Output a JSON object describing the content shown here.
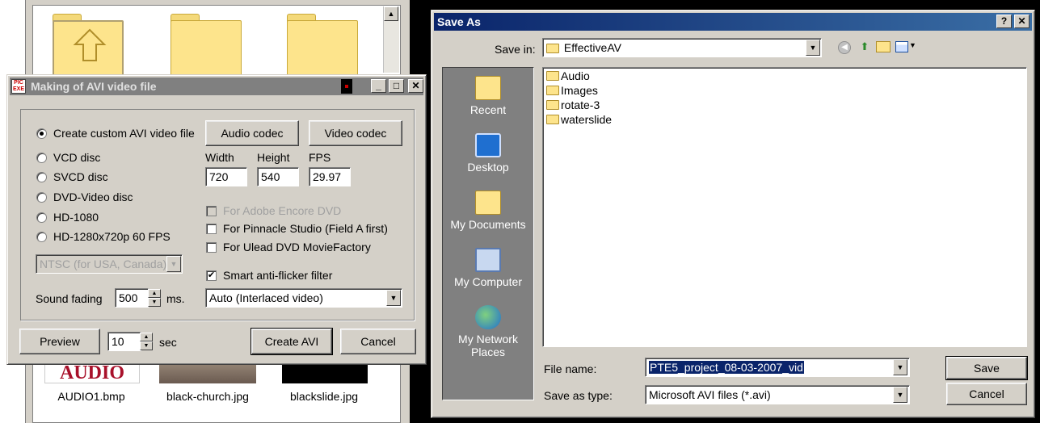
{
  "browser": {
    "thumbs": [
      {
        "caption": "AUDIO1.bmp",
        "label": "AUDIO"
      },
      {
        "caption": "black-church.jpg"
      },
      {
        "caption": "blackslide.jpg"
      }
    ]
  },
  "avi_dialog": {
    "title": "Making of AVI video file",
    "app_icon_text": "PIC EXE",
    "formats": [
      {
        "label": "Create custom AVI video file",
        "selected": true
      },
      {
        "label": "VCD disc",
        "selected": false
      },
      {
        "label": "SVCD disc",
        "selected": false
      },
      {
        "label": "DVD-Video disc",
        "selected": false
      },
      {
        "label": "HD-1080",
        "selected": false
      },
      {
        "label": "HD-1280x720p 60 FPS",
        "selected": false
      }
    ],
    "standard_select": "NTSC (for USA, Canada)",
    "audio_codec_label": "Audio codec",
    "video_codec_label": "Video codec",
    "width_label": "Width",
    "height_label": "Height",
    "fps_label": "FPS",
    "width_value": "720",
    "height_value": "540",
    "fps_value": "29.97",
    "checks": [
      {
        "label": "For Adobe Encore DVD",
        "checked": false,
        "disabled": true
      },
      {
        "label": "For Pinnacle Studio (Field A first)",
        "checked": false,
        "disabled": false
      },
      {
        "label": "For Ulead DVD MovieFactory",
        "checked": false,
        "disabled": false
      }
    ],
    "anti_flicker": {
      "label": "Smart anti-flicker filter",
      "checked": true
    },
    "sound_fading_label": "Sound fading",
    "sound_fading_value": "500",
    "sound_fading_unit": "ms.",
    "interlace_select": "Auto (Interlaced video)",
    "preview_label": "Preview",
    "preview_value": "10",
    "preview_unit": "sec",
    "create_label": "Create AVI",
    "cancel_label": "Cancel"
  },
  "save_dialog": {
    "title": "Save As",
    "save_in_label": "Save in:",
    "save_in_value": "EffectiveAV",
    "places": [
      {
        "label": "Recent"
      },
      {
        "label": "Desktop"
      },
      {
        "label": "My Documents"
      },
      {
        "label": "My Computer"
      },
      {
        "label": "My Network Places"
      }
    ],
    "files": [
      "Audio",
      "Images",
      "rotate-3",
      "waterslide"
    ],
    "file_name_label": "File name:",
    "file_name_value": "PTE5_project_08-03-2007_vid",
    "save_type_label": "Save as type:",
    "save_type_value": "Microsoft AVI files (*.avi)",
    "save_label": "Save",
    "cancel_label": "Cancel"
  }
}
